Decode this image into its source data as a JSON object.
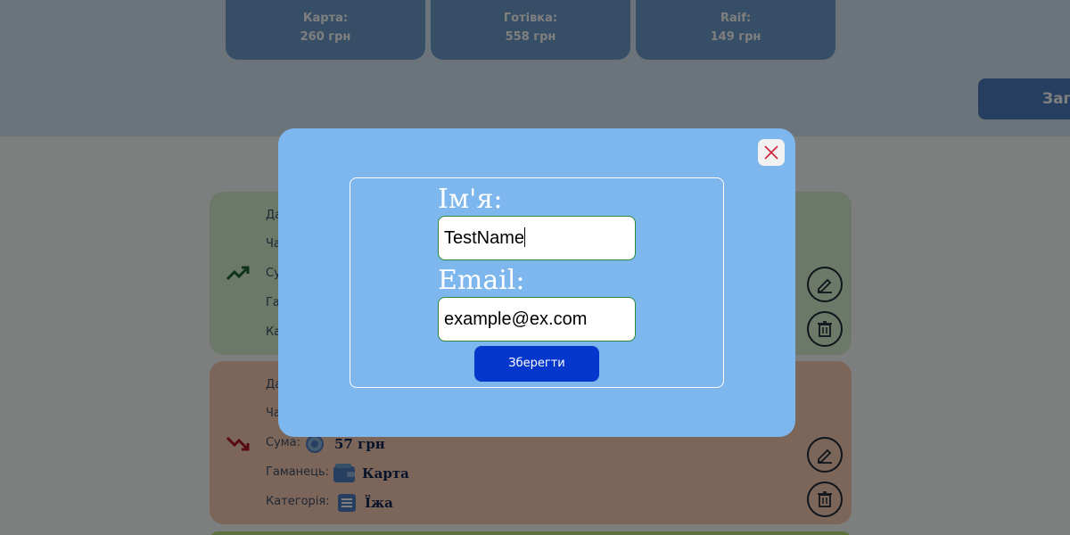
{
  "wallets": [
    {
      "name": "Карта:",
      "amount": "260 грн"
    },
    {
      "name": "Готівка:",
      "amount": "558 грн"
    },
    {
      "name": "Raif:",
      "amount": "149 грн"
    }
  ],
  "header": {
    "load_button_label": "Заг"
  },
  "transactions": {
    "income": {
      "labels": [
        "Да",
        "Ча",
        "Су",
        "Га",
        "Ка"
      ]
    },
    "expense": {
      "labels": [
        "Да",
        "Ча"
      ],
      "sum_label": "Сума:",
      "sum_value": "57 грн",
      "wallet_label": "Гаманець:",
      "wallet_value": "Карта",
      "category_label": "Категорія:",
      "category_value": "Їжа"
    }
  },
  "modal": {
    "name_label": "Ім'я:",
    "name_value": "TestName",
    "email_label": "Email:",
    "email_value": "example@ex.com",
    "save_label": "Зберегти"
  },
  "colors": {
    "modal_bg": "#7eb6ee",
    "save_button": "#0637cc",
    "income_card": "#d8f1d1",
    "expense_card": "#f8ccb3",
    "close_x": "#d0233a"
  }
}
